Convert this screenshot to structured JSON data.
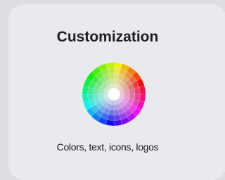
{
  "card": {
    "title": "Customization",
    "caption": "Colors, text, icons, logos",
    "icon": "color-wheel-icon"
  },
  "colors": {
    "background": "#dcdee3",
    "card": "#e9eaee",
    "text": "#1d1d1f"
  }
}
